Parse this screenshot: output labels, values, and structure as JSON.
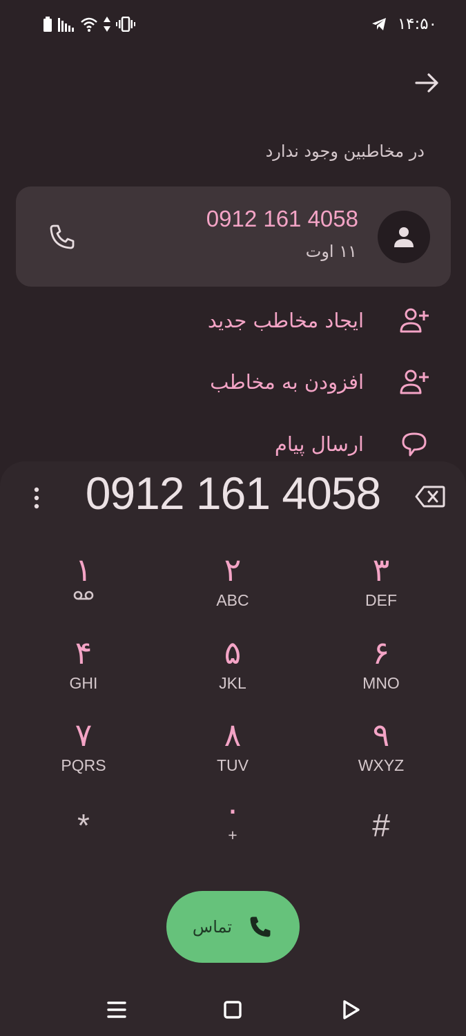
{
  "status_bar": {
    "time": "۱۴:۵۰",
    "icons": [
      "battery-icon",
      "signal-icon",
      "wifi-icon",
      "data-arrows-icon",
      "vibrate-icon",
      "telegram-icon"
    ]
  },
  "header": {
    "subtitle": "در مخاطبین وجود ندارد"
  },
  "contact_card": {
    "number": "0912 161 4058",
    "date": "۱۱ اوت"
  },
  "actions": [
    {
      "label": "ایجاد مخاطب جدید",
      "icon": "add-person-icon"
    },
    {
      "label": "افزودن به مخاطب",
      "icon": "add-person-icon"
    },
    {
      "label": "ارسال پیام",
      "icon": "message-icon"
    }
  ],
  "dialpad": {
    "display": "0912 161 4058",
    "keys": [
      {
        "digit": "۱",
        "letters": ""
      },
      {
        "digit": "۲",
        "letters": "ABC"
      },
      {
        "digit": "۳",
        "letters": "DEF"
      },
      {
        "digit": "۴",
        "letters": "GHI"
      },
      {
        "digit": "۵",
        "letters": "JKL"
      },
      {
        "digit": "۶",
        "letters": "MNO"
      },
      {
        "digit": "۷",
        "letters": "PQRS"
      },
      {
        "digit": "۸",
        "letters": "TUV"
      },
      {
        "digit": "۹",
        "letters": "WXYZ"
      },
      {
        "digit": "*",
        "letters": ""
      },
      {
        "digit": "۰",
        "letters": "+"
      },
      {
        "digit": "#",
        "letters": ""
      }
    ]
  },
  "call_button": {
    "label": "تماس"
  },
  "colors": {
    "background": "#2b2226",
    "accent_pink": "#f4a4c6",
    "call_green": "#66c27b"
  }
}
